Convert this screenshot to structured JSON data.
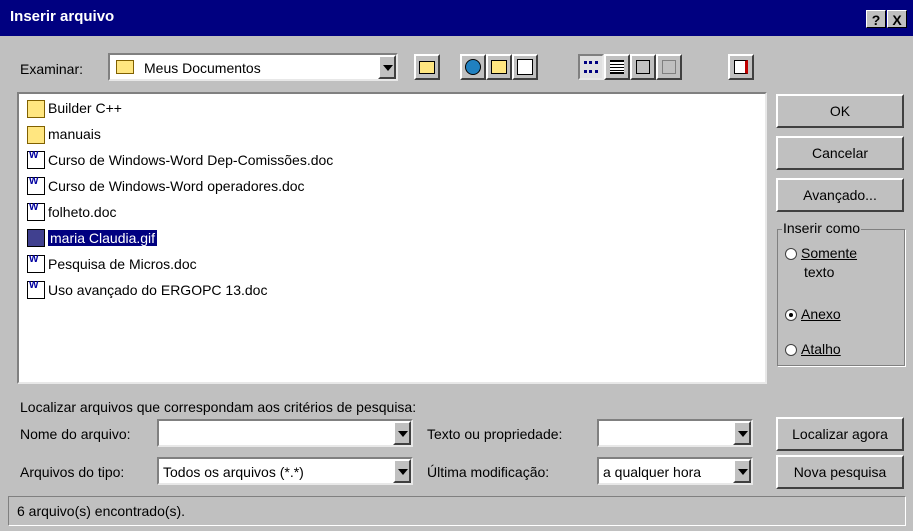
{
  "window": {
    "title": "Inserir arquivo",
    "help_button": "?",
    "close_button": "X"
  },
  "toolbar": {
    "look_in_label": "Examinar:",
    "look_in_value": "Meus Documentos"
  },
  "files": [
    {
      "name": "Builder C++",
      "type": "folder"
    },
    {
      "name": "manuais",
      "type": "folder"
    },
    {
      "name": "Curso de Windows-Word Dep-Comissões.doc",
      "type": "doc"
    },
    {
      "name": "Curso de Windows-Word operadores.doc",
      "type": "doc"
    },
    {
      "name": "folheto.doc",
      "type": "doc"
    },
    {
      "name": "maria Claudia.gif",
      "type": "gif",
      "selected": true
    },
    {
      "name": "Pesquisa de Micros.doc",
      "type": "doc"
    },
    {
      "name": "Uso avançado do ERGOPC 13.doc",
      "type": "doc"
    }
  ],
  "buttons": {
    "ok": "OK",
    "cancel": "Cancelar",
    "advanced": "Avançado...",
    "find_now": "Localizar agora",
    "new_search": "Nova pesquisa"
  },
  "insert_as": {
    "label": "Inserir como",
    "option_text_1": "Somente",
    "option_text_2": "texto",
    "option_attachment": "Anexo",
    "option_shortcut": "Atalho",
    "selected": "Anexo"
  },
  "search": {
    "heading": "Localizar arquivos que correspondam aos critérios de pesquisa:",
    "file_name_label": "Nome do arquivo:",
    "file_name_value": "",
    "text_property_label": "Texto ou propriedade:",
    "text_property_value": "",
    "file_type_label": "Arquivos do tipo:",
    "file_type_value": "Todos os arquivos (*.*)",
    "last_modified_label": "Última modificação:",
    "last_modified_value": "a qualquer hora"
  },
  "status": "6 arquivo(s) encontrado(s)."
}
